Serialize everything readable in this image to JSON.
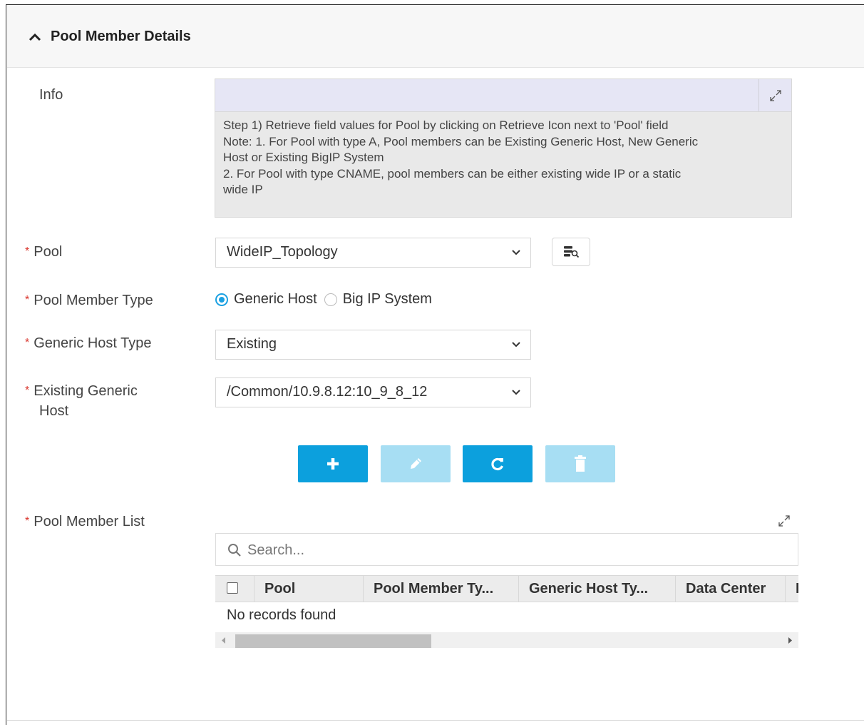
{
  "panel": {
    "title": "Pool Member Details"
  },
  "info": {
    "label": "Info",
    "lines": [
      "Step 1) Retrieve field values for Pool by clicking on Retrieve Icon next to 'Pool' field",
      "Note: 1. For Pool with type A, Pool members can be Existing Generic Host, New Generic",
      "Host or Existing BigIP System",
      "2. For Pool with type CNAME, pool members can be either existing wide IP or a static",
      "wide IP"
    ]
  },
  "fields": {
    "required_mark": "*",
    "pool": {
      "label": "Pool",
      "value": "WideIP_Topology"
    },
    "pool_member_type": {
      "label": "Pool Member Type",
      "options": [
        "Generic Host",
        "Big IP System"
      ],
      "selected": "Generic Host"
    },
    "generic_host_type": {
      "label": "Generic Host Type",
      "value": "Existing"
    },
    "existing_generic_host": {
      "label_line1": "Existing Generic",
      "label_line2": "Host",
      "value": "/Common/10.9.8.12:10_9_8_12"
    }
  },
  "actions": {
    "add": {
      "icon": "plus-icon",
      "enabled": true
    },
    "edit": {
      "icon": "pencil-icon",
      "enabled": false
    },
    "refresh": {
      "icon": "refresh-icon",
      "enabled": true
    },
    "delete": {
      "icon": "trash-icon",
      "enabled": false
    }
  },
  "pool_member_list": {
    "label": "Pool Member List",
    "search_placeholder": "Search...",
    "columns": [
      "Pool",
      "Pool Member Ty...",
      "Generic Host Ty...",
      "Data Center",
      "I"
    ],
    "empty_text": "No records found"
  },
  "colors": {
    "accent": "#0ca0dd",
    "accent_disabled": "#a7def3",
    "required": "#d9342b",
    "radio": "#1ba1e2"
  }
}
